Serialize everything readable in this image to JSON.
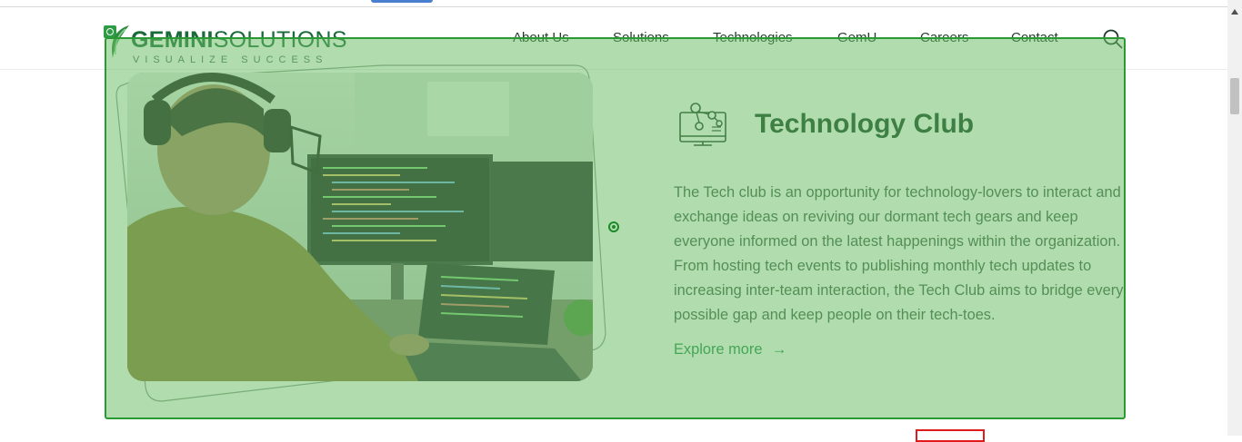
{
  "logo": {
    "brand_bold": "GEMINI",
    "brand_light": "SOLUTIONS",
    "tagline": "VISUALIZE SUCCESS"
  },
  "nav": {
    "items": [
      {
        "label": "About Us"
      },
      {
        "label": "Solutions"
      },
      {
        "label": "Technologies"
      },
      {
        "label": "GemU"
      },
      {
        "label": "Careers"
      },
      {
        "label": "Contact"
      }
    ],
    "search_icon": "search-icon"
  },
  "club": {
    "icon": "computer-network-icon",
    "title": "Technology Club",
    "description": "The Tech club is an opportunity for technology-lovers to interact and exchange ideas on reviving our dormant tech gears and keep everyone informed on the latest happenings within the organization. From hosting tech events to publishing monthly tech updates to increasing inter-team interaction, the Tech Club aims to bridge every possible gap and keep people on their tech-toes.",
    "explore_label": "Explore more",
    "explore_arrow": "→"
  },
  "colors": {
    "brand_green": "#1b6b3a",
    "title_dark_green": "#0f3d23",
    "link_green": "#1f8a4a",
    "overlay_green": "#6abe64",
    "overlay_border": "#2a9a34",
    "alert_red": "#e01b1b"
  }
}
